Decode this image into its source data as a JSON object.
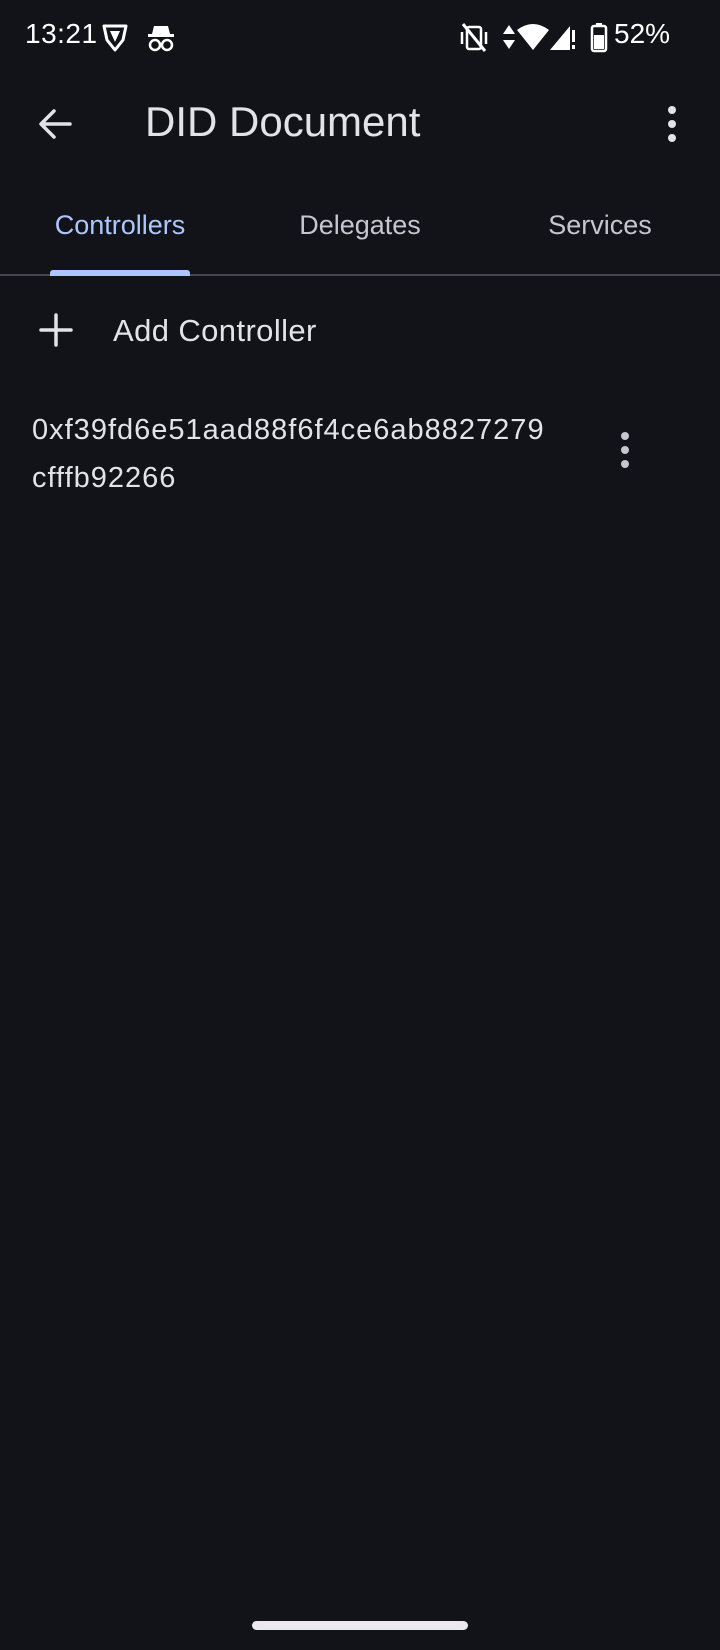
{
  "status_bar": {
    "time": "13:21",
    "battery": "52%",
    "icons": [
      "vpn-shield-icon",
      "incognito-icon",
      "mute-vibrate-icon",
      "data-arrows-icon",
      "wifi-icon",
      "signal-icon",
      "battery-icon"
    ]
  },
  "app_bar": {
    "title": "DID Document",
    "back_icon": "arrow-back-icon",
    "menu_icon": "more-vert-icon"
  },
  "tabs": [
    {
      "label": "Controllers",
      "active": true
    },
    {
      "label": "Delegates",
      "active": false
    },
    {
      "label": "Services",
      "active": false
    }
  ],
  "add_controller": {
    "label": "Add Controller",
    "icon": "plus-icon"
  },
  "controllers": [
    {
      "address": "0xf39fd6e51aad88f6f4ce6ab8827279cfffb92266",
      "menu_icon": "more-vert-icon"
    }
  ],
  "colors": {
    "background": "#121318",
    "accent": "#aec6ff",
    "text": "#e3e2e9",
    "divider": "#45464f"
  }
}
